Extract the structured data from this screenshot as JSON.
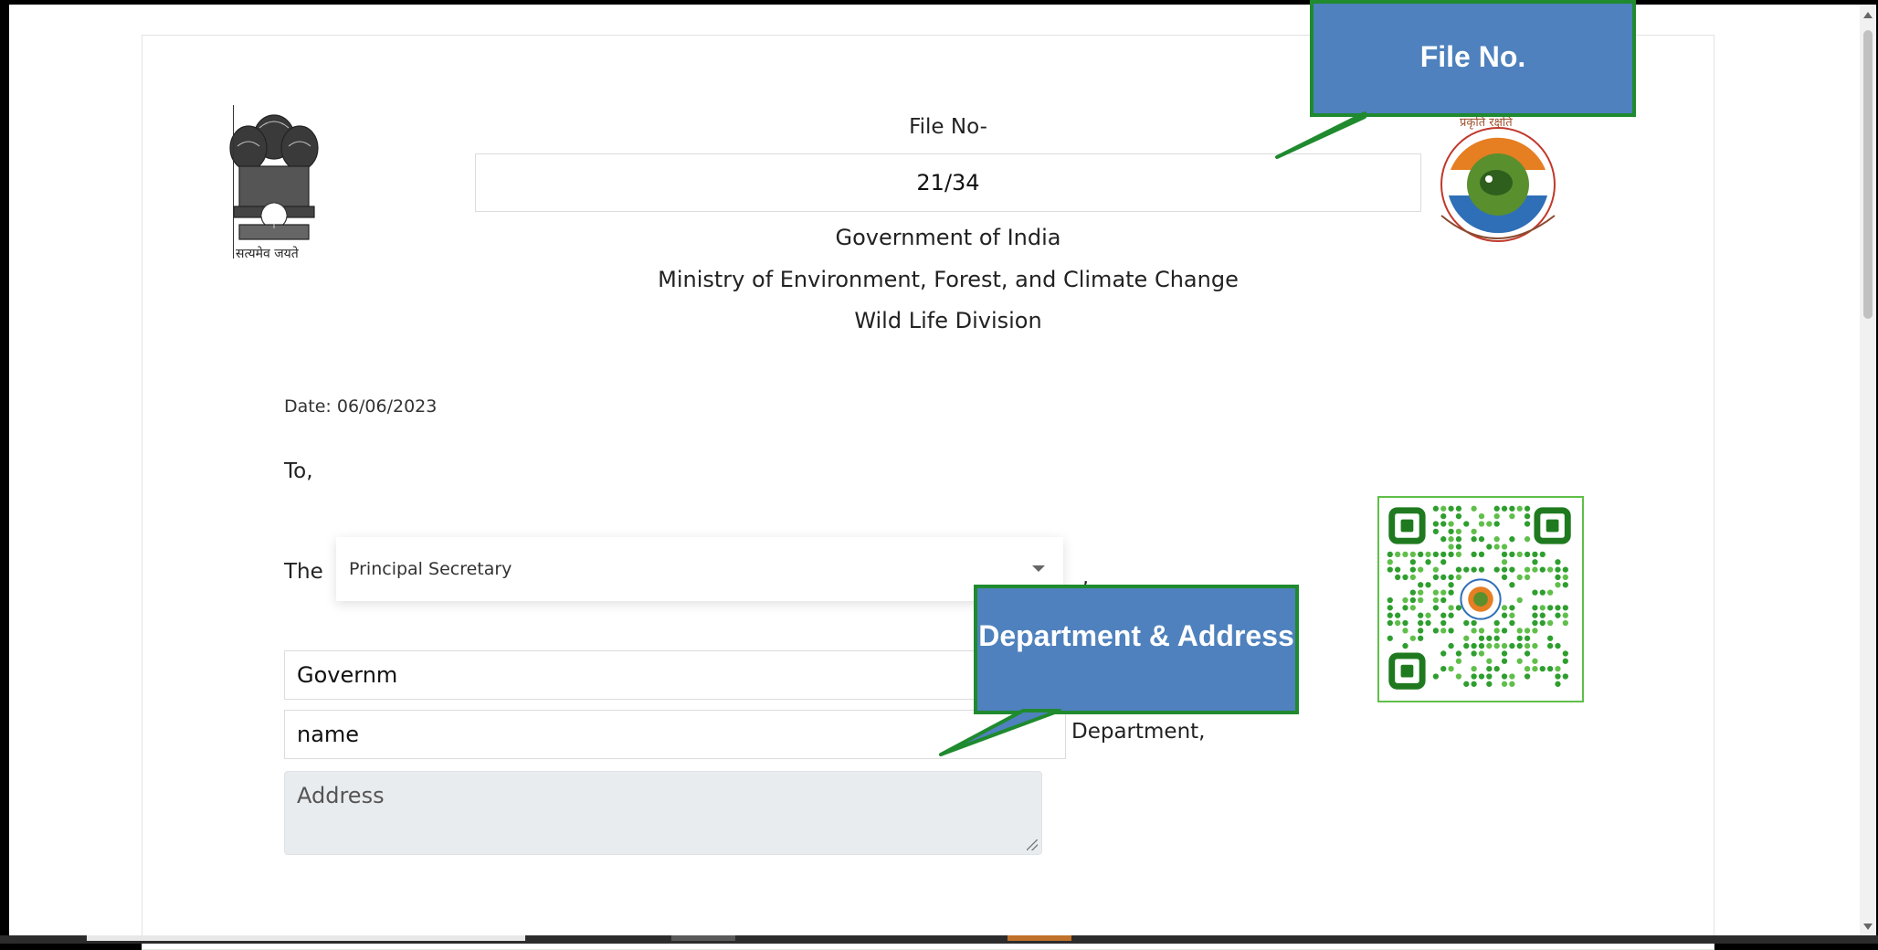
{
  "document": {
    "file_label": "File No-",
    "file_number": "21/34",
    "government": "Government of India",
    "ministry": "Ministry of Environment, Forest, and Climate Change",
    "division": "Wild Life Division",
    "emblem_caption": "सत्यमेव जयते",
    "date": "Date: 06/06/2023",
    "to": "To,",
    "the": "The",
    "designation_selected": "Principal Secretary",
    "comma": ",",
    "field_government": "Governm",
    "field_name": "name",
    "department_suffix": "Department,",
    "address_placeholder": "Address"
  },
  "callouts": {
    "file": "File No.",
    "department": "Department & Address"
  },
  "colors": {
    "callout_fill": "#4e81bd",
    "callout_border": "#1f8a2e",
    "qr_green": "#2e9e2e"
  },
  "icons": {
    "emblem": "national-emblem-icon",
    "logo": "moefcc-logo-icon",
    "qr": "qr-code-icon",
    "caret": "chevron-down-icon"
  }
}
